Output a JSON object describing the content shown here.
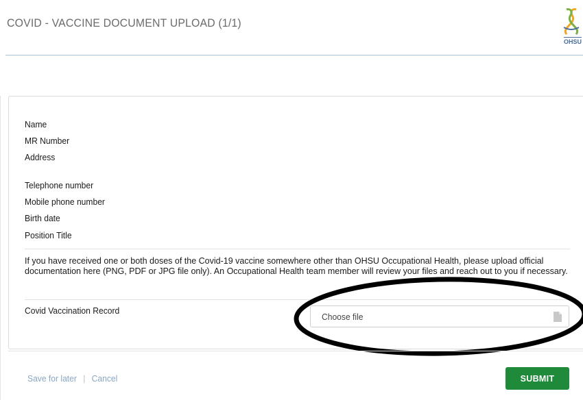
{
  "header": {
    "title": "COVID - VACCINE DOCUMENT UPLOAD (1/1)",
    "logo_text": "OHSU"
  },
  "profile": {
    "fields": [
      {
        "label": "Name"
      },
      {
        "label": "MR Number"
      },
      {
        "label": "Address"
      },
      {
        "label": "Telephone number"
      },
      {
        "label": "Mobile phone number"
      },
      {
        "label": "Birth date"
      },
      {
        "label": "Position Title"
      }
    ]
  },
  "instructions": "If you have received one or both doses of the Covid-19 vaccine somewhere other than OHSU Occupational Health, please upload official documentation here (PNG, PDF or JPG file only). An Occupational Health team member will review your files and reach out to you if necessary.",
  "upload": {
    "label": "Covid Vaccination Record",
    "placeholder": "Choose file",
    "icon": "file-icon"
  },
  "footer": {
    "save_label": "Save for later",
    "separator": "|",
    "cancel_label": "Cancel",
    "submit_label": "SUBMIT"
  },
  "colors": {
    "submit": "#1f8a3a",
    "link": "#8aa6c4",
    "header_rule": "#a7c1d8",
    "annotation": "#000000"
  }
}
